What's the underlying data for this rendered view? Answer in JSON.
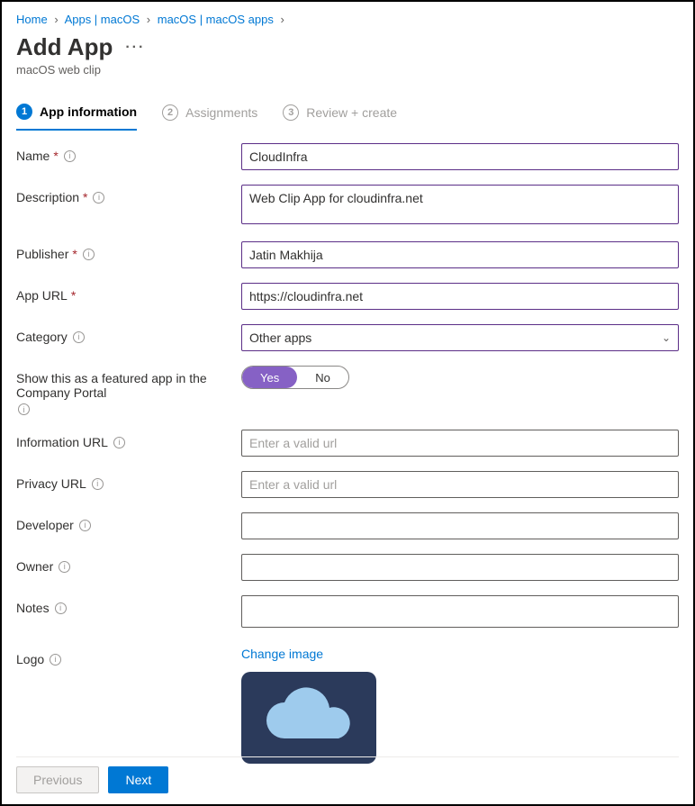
{
  "breadcrumb": {
    "items": [
      {
        "label": "Home"
      },
      {
        "label": "Apps | macOS"
      },
      {
        "label": "macOS | macOS apps"
      }
    ]
  },
  "header": {
    "title": "Add App",
    "subtitle": "macOS web clip"
  },
  "steps": {
    "s1": "App information",
    "s2": "Assignments",
    "s3": "Review + create"
  },
  "form": {
    "name": {
      "label": "Name",
      "value": "CloudInfra"
    },
    "description": {
      "label": "Description",
      "value": "Web Clip App for cloudinfra.net"
    },
    "publisher": {
      "label": "Publisher",
      "value": "Jatin Makhija"
    },
    "appurl": {
      "label": "App URL",
      "value": "https://cloudinfra.net"
    },
    "category": {
      "label": "Category",
      "value": "Other apps"
    },
    "featured": {
      "label": "Show this as a featured app in the Company Portal",
      "yes": "Yes",
      "no": "No"
    },
    "infourl": {
      "label": "Information URL",
      "placeholder": "Enter a valid url"
    },
    "privurl": {
      "label": "Privacy URL",
      "placeholder": "Enter a valid url"
    },
    "developer": {
      "label": "Developer"
    },
    "owner": {
      "label": "Owner"
    },
    "notes": {
      "label": "Notes"
    },
    "logo": {
      "label": "Logo",
      "change": "Change image"
    }
  },
  "footer": {
    "prev": "Previous",
    "next": "Next"
  }
}
